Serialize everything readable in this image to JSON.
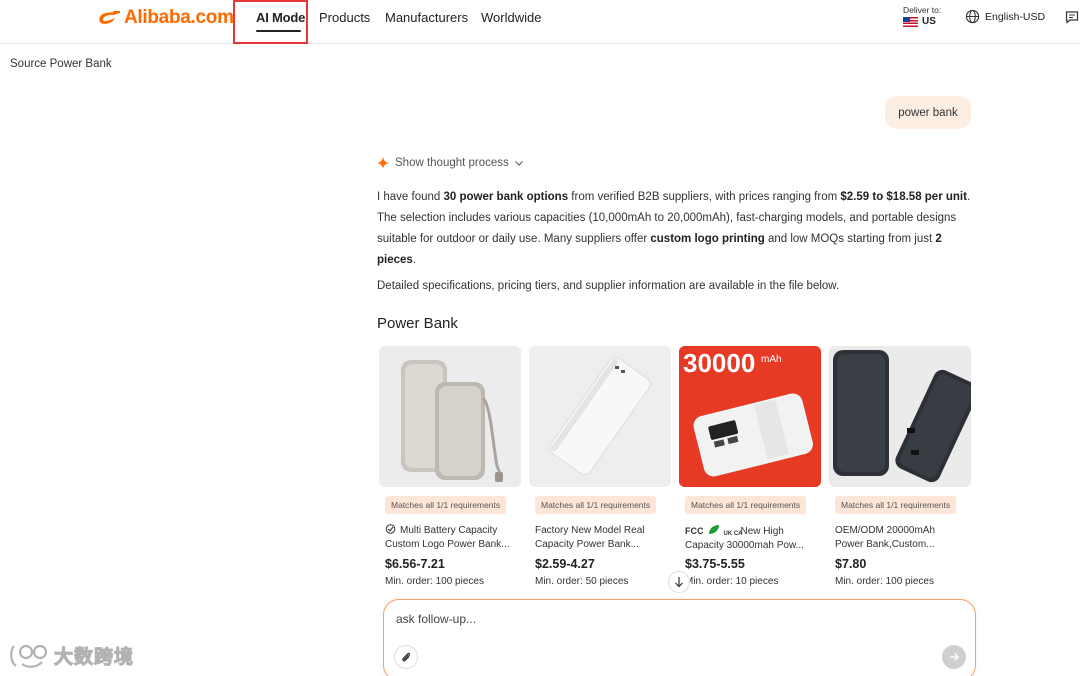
{
  "header": {
    "logo_text": "Alibaba.com",
    "nav": {
      "ai_mode": "AI Mode",
      "products": "Products",
      "manufacturers": "Manufacturers",
      "worldwide": "Worldwide"
    },
    "deliver_label": "Deliver to:",
    "deliver_country": "US",
    "language": "English-USD"
  },
  "breadcrumb": "Source Power Bank",
  "chat": {
    "user_query": "power bank",
    "thought_toggle": "Show thought process",
    "answer": {
      "p1_a": "I have found ",
      "p1_b": "30 power bank options",
      "p1_c": " from verified B2B suppliers, with prices ranging from ",
      "p1_d": "$2.59 to $18.58 per unit",
      "p1_e": ". The selection includes various capacities (10,000mAh to 20,000mAh), fast-charging models, and portable designs suitable for outdoor or daily use. Many suppliers offer ",
      "p1_f": "custom logo printing",
      "p1_g": " and low MOQs starting from just ",
      "p1_h": "2 pieces",
      "p1_i": ".",
      "p2": "Detailed specifications, pricing tiers, and supplier information are available in the file below."
    },
    "section_title": "Power Bank"
  },
  "products": [
    {
      "badge": "Matches all 1/1 requirements",
      "title_line1": "Multi Battery Capacity",
      "title_line2": "Custom Logo Power Bank...",
      "price": "$6.56-7.21",
      "moq": "Min. order: 100 pieces"
    },
    {
      "badge": "Matches all 1/1 requirements",
      "title_line1": "Factory New Model Real",
      "title_line2": "Capacity Power Bank...",
      "price": "$2.59-4.27",
      "moq": "Min. order: 50 pieces"
    },
    {
      "badge": "Matches all 1/1 requirements",
      "cert_fcc": "FCC",
      "cert_ukca": "UK CA",
      "title_line1": "New High",
      "title_line2": "Capacity 30000mah Pow...",
      "price": "$3.75-5.55",
      "moq": "Min. order: 10 pieces",
      "image_text_big": "30000",
      "image_text_unit": "mAh"
    },
    {
      "badge": "Matches all 1/1 requirements",
      "title_line1": "OEM/ODM 20000mAh",
      "title_line2": "Power Bank,Custom...",
      "price": "$7.80",
      "moq": "Min. order: 100 pieces"
    }
  ],
  "composer": {
    "placeholder": "ask follow-up..."
  },
  "watermark": "大数跨境",
  "colors": {
    "brand": "#ff6a00",
    "highlight_box": "#e53935",
    "user_bubble": "#fdeee4",
    "badge_bg": "#fde5d8"
  }
}
